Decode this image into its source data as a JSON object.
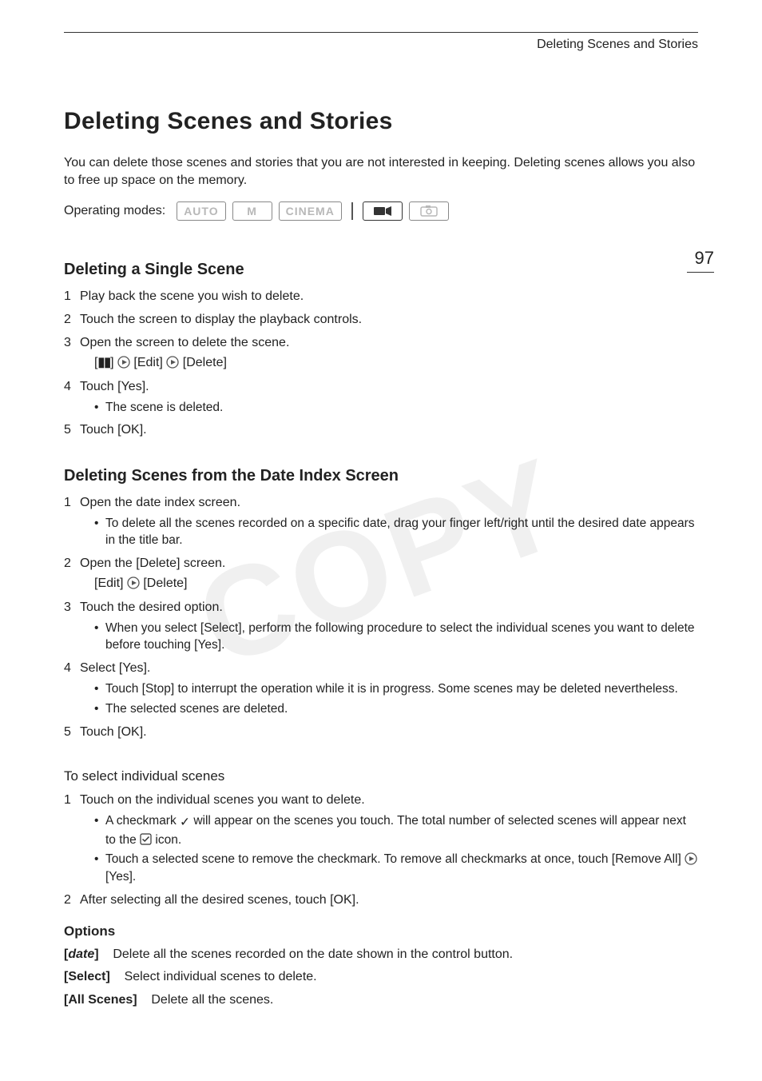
{
  "header": "Deleting Scenes and Stories",
  "page_number": "97",
  "title": "Deleting Scenes and Stories",
  "intro": "You can delete those scenes and stories that you are not interested in keeping. Deleting scenes allows you also to free up space on the memory.",
  "modes_label": "Operating modes:",
  "modes": {
    "auto": "AUTO",
    "m": "M",
    "cinema": "CINEMA"
  },
  "watermark": "COPY",
  "section1": {
    "heading": "Deleting a Single Scene",
    "steps": [
      "Play back the scene you wish to delete.",
      "Touch the screen to display the playback controls.",
      "Open the screen to delete the scene.",
      "Touch [Yes].",
      "Touch [OK]."
    ],
    "step3_path_a": "[",
    "step3_path_b": "] ",
    "step3_edit": " [Edit] ",
    "step3_delete": " [Delete]",
    "step4_bullet": "The scene is deleted."
  },
  "section2": {
    "heading": "Deleting Scenes from the Date Index Screen",
    "steps": {
      "s1": "Open the date index screen.",
      "s1_b1": "To delete all the scenes recorded on a specific date, drag your finger left/right until the desired date appears in the title bar.",
      "s2": "Open the [Delete] screen.",
      "s2_path_a": "[Edit] ",
      "s2_path_b": " [Delete]",
      "s3": "Touch the desired option.",
      "s3_b1": "When you select [Select], perform the following procedure to select the individual scenes you want to delete before touching [Yes].",
      "s4": "Select [Yes].",
      "s4_b1": "Touch [Stop] to interrupt the operation while it is in progress. Some scenes may be deleted nevertheless.",
      "s4_b2": "The selected scenes are deleted.",
      "s5": "Touch [OK]."
    }
  },
  "section3": {
    "heading": "To select individual scenes",
    "s1": "Touch on the individual scenes you want to delete.",
    "s1_b1_a": "A checkmark ",
    "s1_b1_b": " will appear on the scenes you touch. The total number of selected scenes will appear next to the ",
    "s1_b1_c": " icon.",
    "s1_b2_a": "Touch a selected scene to remove the checkmark. To remove all checkmarks at once, touch [Remove All] ",
    "s1_b2_b": " [Yes].",
    "s2": "After selecting all the desired scenes, touch [OK]."
  },
  "options": {
    "heading": "Options",
    "rows": [
      {
        "label": "[date]",
        "italic": true,
        "desc": "Delete all the scenes recorded on the date shown in the control button."
      },
      {
        "label": "[Select]",
        "italic": false,
        "desc": "Select individual scenes to delete."
      },
      {
        "label": "[All Scenes]",
        "italic": false,
        "desc": "Delete all the scenes."
      }
    ]
  }
}
